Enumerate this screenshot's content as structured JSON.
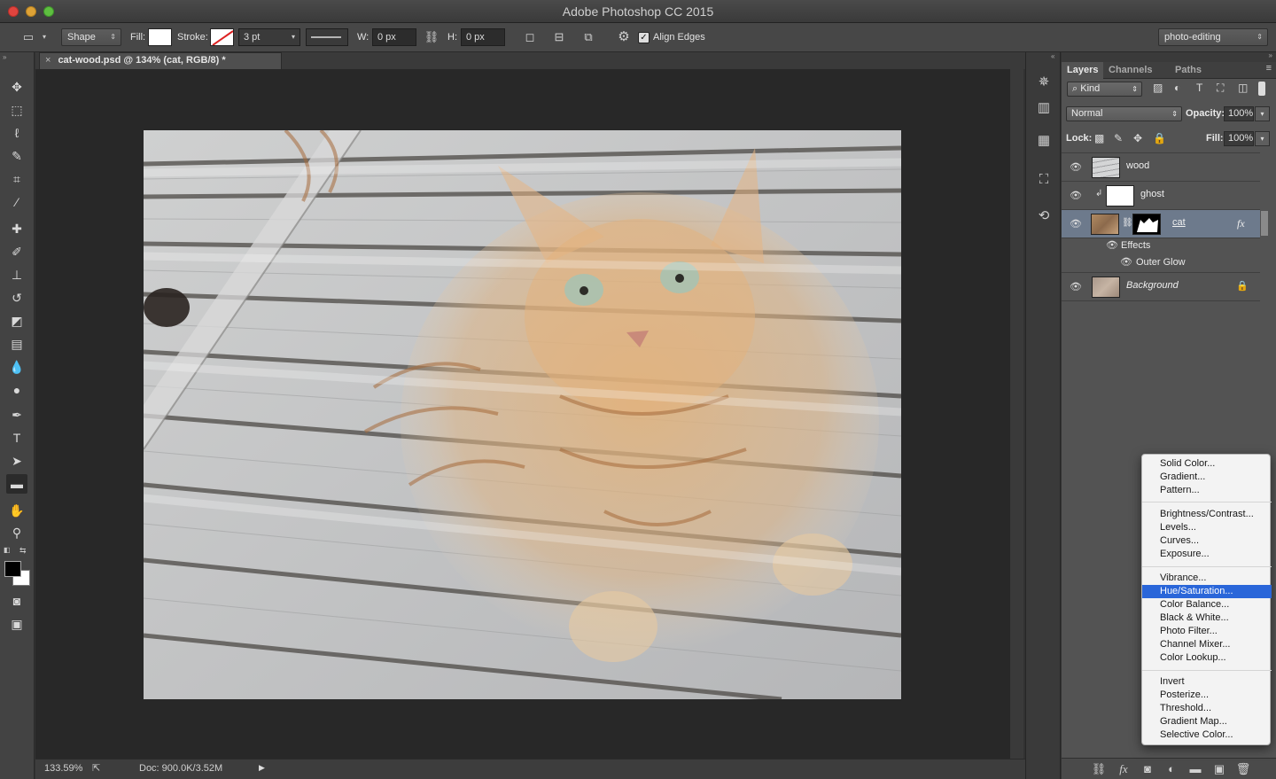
{
  "window": {
    "title": "Adobe Photoshop CC 2015"
  },
  "options_bar": {
    "mode": "Shape",
    "fill_label": "Fill:",
    "stroke_label": "Stroke:",
    "stroke_width": "3 pt",
    "w_label": "W:",
    "w_value": "0 px",
    "h_label": "H:",
    "h_value": "0 px",
    "align_edges_label": "Align Edges",
    "align_edges_checked": true,
    "workspace": "photo-editing"
  },
  "document": {
    "tab_title": "cat-wood.psd @ 134% (cat, RGB/8) *",
    "zoom": "133.59%",
    "doc_size": "Doc: 900.0K/3.52M"
  },
  "layers_panel": {
    "tabs": [
      "Layers",
      "Channels",
      "Paths"
    ],
    "filter_kind": "Kind",
    "blend_mode": "Normal",
    "opacity_label": "Opacity:",
    "opacity": "100%",
    "lock_label": "Lock:",
    "fill_label": "Fill:",
    "fill": "100%",
    "layers": [
      {
        "name": "wood",
        "visible": true,
        "selected": false
      },
      {
        "name": "ghost",
        "visible": true,
        "selected": false
      },
      {
        "name": "cat",
        "visible": true,
        "selected": true,
        "has_fx": true,
        "fx_label": "fx"
      },
      {
        "name": "Background",
        "visible": true,
        "selected": false,
        "locked": true
      }
    ],
    "effects_label": "Effects",
    "effect_item": "Outer Glow"
  },
  "adjustment_menu": {
    "groups": [
      [
        "Solid Color...",
        "Gradient...",
        "Pattern..."
      ],
      [
        "Brightness/Contrast...",
        "Levels...",
        "Curves...",
        "Exposure..."
      ],
      [
        "Vibrance...",
        "Hue/Saturation...",
        "Color Balance...",
        "Black & White...",
        "Photo Filter...",
        "Channel Mixer...",
        "Color Lookup..."
      ],
      [
        "Invert",
        "Posterize...",
        "Threshold...",
        "Gradient Map...",
        "Selective Color..."
      ]
    ],
    "highlighted": "Hue/Saturation..."
  },
  "colors": {
    "selection_blue": "#2a66d9",
    "selected_layer": "#6d7a8c",
    "panel_bg": "#535353"
  }
}
